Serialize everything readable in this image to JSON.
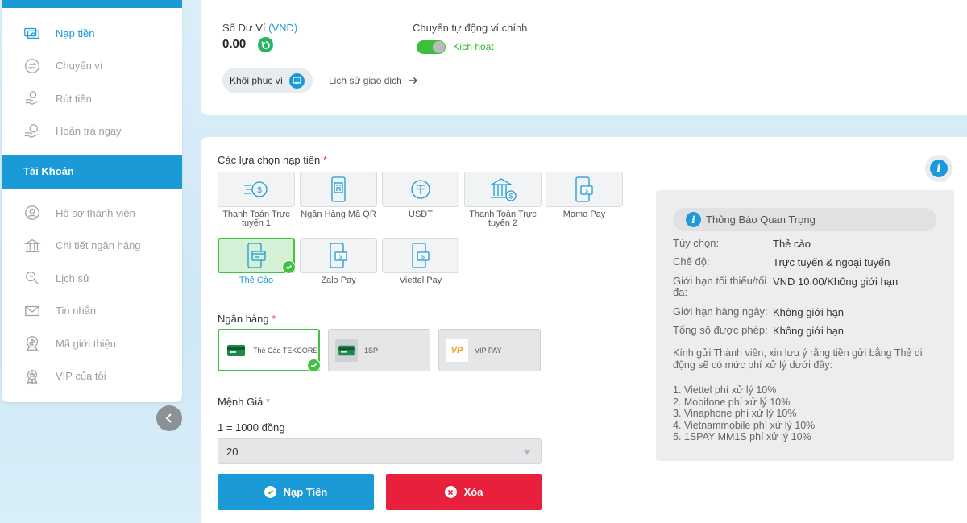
{
  "sidebar": {
    "items_top": [
      {
        "label": "Nạp tiền",
        "icon": "deposit-icon",
        "active": true
      },
      {
        "label": "Chuyển ví",
        "icon": "transfer-icon"
      },
      {
        "label": "Rút tiền",
        "icon": "withdraw-icon"
      },
      {
        "label": "Hoàn trả ngay",
        "icon": "rebate-icon"
      }
    ],
    "section_title": "Tài Khoản",
    "items_account": [
      {
        "label": "Hồ sơ thành viên",
        "icon": "user-icon"
      },
      {
        "label": "Chi tiết ngân hàng",
        "icon": "bank-icon"
      },
      {
        "label": "Lịch sử",
        "icon": "history-icon"
      },
      {
        "label": "Tin nhắn",
        "icon": "mail-icon"
      },
      {
        "label": "Mã giới thiệu",
        "icon": "referral-icon"
      },
      {
        "label": "VIP của tôi",
        "icon": "vip-icon"
      }
    ]
  },
  "wallet": {
    "balance_label": "Số Dư Ví",
    "currency": "(VND)",
    "balance": "0.00",
    "auto_transfer_label": "Chuyển tự động ví chính",
    "toggle_text": "Kích hoạt",
    "toggle_on": true,
    "restore_label": "Khôi phục ví",
    "history_link": "Lịch sử giao dịch"
  },
  "deposit": {
    "methods_label": "Các lựa chọn nạp tiền",
    "required_mark": "*",
    "methods": [
      {
        "label": "Thanh Toán Trực tuyến 1",
        "icon": "online-payment-icon"
      },
      {
        "label": "Ngân Hàng Mã QR",
        "icon": "qr-bank-icon"
      },
      {
        "label": "USDT",
        "icon": "usdt-icon"
      },
      {
        "label": "Thanh Toán Trực tuyến 2",
        "icon": "bank-building-icon"
      },
      {
        "label": "Momo Pay",
        "icon": "phone-wallet-icon"
      },
      {
        "label": "Thẻ Cào",
        "icon": "scratch-card-icon",
        "selected": true
      },
      {
        "label": "Zalo Pay",
        "icon": "phone-wallet-icon"
      },
      {
        "label": "Viettel Pay",
        "icon": "phone-wallet-icon"
      }
    ],
    "bank_label": "Ngân hàng",
    "banks": [
      {
        "label": "Thẻ Cào TEKCORE",
        "selected": true
      },
      {
        "label": "1SP"
      },
      {
        "label": "VIP PAY",
        "logo_text": "VP"
      }
    ],
    "denomination_label": "Mệnh Giá",
    "rate_text": "1 = 1000 đồng",
    "denomination_value": "20",
    "submit_label": "Nạp Tiền",
    "clear_label": "Xóa"
  },
  "notice": {
    "title": "Thông Báo Quan Trọng",
    "rows": [
      {
        "key": "Tùy chọn:",
        "value": "Thẻ cào"
      },
      {
        "key": "Chế độ:",
        "value": "Trực tuyến & ngoại tuyến"
      },
      {
        "key": "Giới hạn tối thiểu/tối đa:",
        "value": "VND 10.00/Không giới hạn"
      },
      {
        "key": "Giới hạn hàng ngày:",
        "value": "Không giới hạn"
      },
      {
        "key": "Tổng số được phép:",
        "value": "Không giới hạn"
      }
    ],
    "message": "Kính gửi Thành viên, xin lưu ý rằng tiền gửi bằng Thẻ di động sẽ có mức phí xử lý dưới đây:",
    "fees": [
      "1. Viettel phí xử lý 10%",
      "2. Mobifone phí xử lý 10%",
      "3. Vinaphone phí xử lý 10%",
      "4. Vietnammobile phí xử lý 10%",
      "5. 1SPAY MM1S phí xử lý 10%"
    ]
  },
  "colors": {
    "primary": "#1a9ad6",
    "success": "#43c143",
    "danger": "#e8203c"
  }
}
